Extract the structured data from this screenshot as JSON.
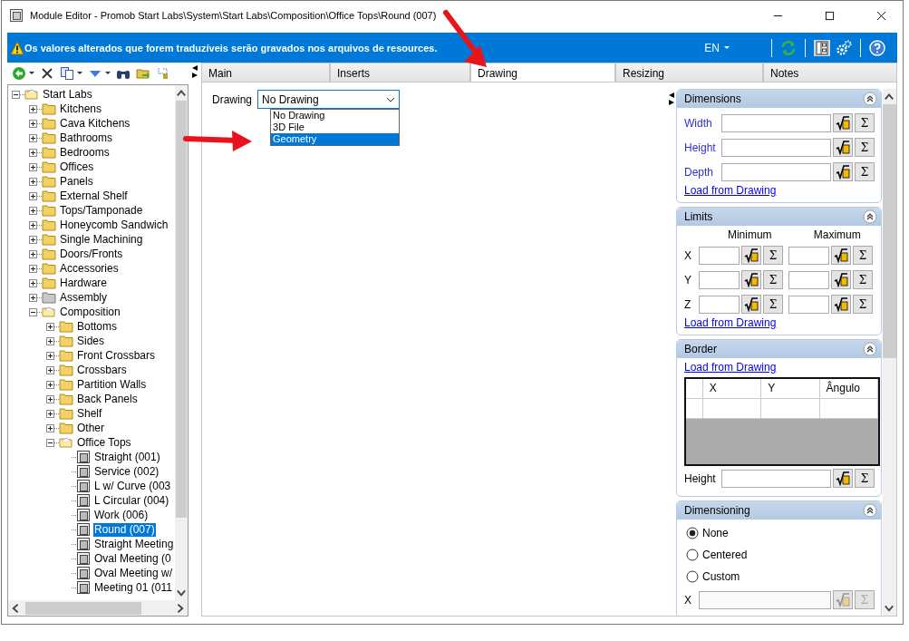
{
  "window": {
    "title": "Module Editor - Promob Start Labs\\System\\Start Labs\\Composition\\Office Tops\\Round (007)"
  },
  "banner": {
    "message": "Os valores alterados que forem traduzíveis serão gravados nos arquivos de resources.",
    "language": "EN"
  },
  "tree": [
    {
      "label": "Start Labs",
      "kind": "folder",
      "expanded": true,
      "selected": false,
      "children": [
        {
          "label": "Kitchens",
          "kind": "folder",
          "expanded": false,
          "selected": false
        },
        {
          "label": "Cava Kitchens",
          "kind": "folder",
          "expanded": false,
          "selected": false
        },
        {
          "label": "Bathrooms",
          "kind": "folder",
          "expanded": false,
          "selected": false
        },
        {
          "label": "Bedrooms",
          "kind": "folder",
          "expanded": false,
          "selected": false
        },
        {
          "label": "Offices",
          "kind": "folder",
          "expanded": false,
          "selected": false
        },
        {
          "label": "Panels",
          "kind": "folder",
          "expanded": false,
          "selected": false
        },
        {
          "label": "External Shelf",
          "kind": "folder",
          "expanded": false,
          "selected": false
        },
        {
          "label": "Tops/Tamponade",
          "kind": "folder",
          "expanded": false,
          "selected": false
        },
        {
          "label": "Honeycomb Sandwich",
          "kind": "folder",
          "expanded": false,
          "selected": false
        },
        {
          "label": "Single Machining",
          "kind": "folder",
          "expanded": false,
          "selected": false
        },
        {
          "label": "Doors/Fronts",
          "kind": "folder",
          "expanded": false,
          "selected": false
        },
        {
          "label": "Accessories",
          "kind": "folder",
          "expanded": false,
          "selected": false
        },
        {
          "label": "Hardware",
          "kind": "folder",
          "expanded": false,
          "selected": false
        },
        {
          "label": "Assembly",
          "kind": "gray-folder",
          "expanded": false,
          "selected": false
        },
        {
          "label": "Composition",
          "kind": "folder",
          "expanded": true,
          "selected": false,
          "children": [
            {
              "label": "Bottoms",
              "kind": "folder",
              "expanded": false,
              "selected": false
            },
            {
              "label": "Sides",
              "kind": "folder",
              "expanded": false,
              "selected": false
            },
            {
              "label": "Front Crossbars",
              "kind": "folder",
              "expanded": false,
              "selected": false
            },
            {
              "label": "Crossbars",
              "kind": "folder",
              "expanded": false,
              "selected": false
            },
            {
              "label": "Partition Walls",
              "kind": "folder",
              "expanded": false,
              "selected": false
            },
            {
              "label": "Back Panels",
              "kind": "folder",
              "expanded": false,
              "selected": false
            },
            {
              "label": "Shelf",
              "kind": "folder",
              "expanded": false,
              "selected": false
            },
            {
              "label": "Other",
              "kind": "folder",
              "expanded": false,
              "selected": false
            },
            {
              "label": "Office Tops",
              "kind": "folder",
              "expanded": true,
              "selected": false,
              "children": [
                {
                  "label": "Straight (001)",
                  "kind": "module",
                  "selected": false
                },
                {
                  "label": "Service (002)",
                  "kind": "module",
                  "selected": false
                },
                {
                  "label": "L w/ Curve (003",
                  "kind": "module",
                  "selected": false
                },
                {
                  "label": "L Circular (004)",
                  "kind": "module",
                  "selected": false
                },
                {
                  "label": "Work (006)",
                  "kind": "module",
                  "selected": false
                },
                {
                  "label": "Round (007)",
                  "kind": "module",
                  "selected": true
                },
                {
                  "label": "Straight Meeting",
                  "kind": "module",
                  "selected": false
                },
                {
                  "label": "Oval Meeting (0",
                  "kind": "module",
                  "selected": false
                },
                {
                  "label": "Oval Meeting w/",
                  "kind": "module",
                  "selected": false
                },
                {
                  "label": "Meeting 01 (011",
                  "kind": "module",
                  "selected": false
                }
              ]
            }
          ]
        }
      ]
    }
  ],
  "tabs": [
    {
      "label": "Main",
      "selected": false
    },
    {
      "label": "Inserts",
      "selected": false
    },
    {
      "label": "Drawing",
      "selected": true
    },
    {
      "label": "Resizing",
      "selected": false
    },
    {
      "label": "Notes",
      "selected": false
    }
  ],
  "drawing": {
    "label": "Drawing",
    "value": "No Drawing",
    "expanded": true,
    "options": [
      {
        "label": "No Drawing",
        "highlighted": false
      },
      {
        "label": "3D File",
        "highlighted": false
      },
      {
        "label": "Geometry",
        "highlighted": true
      }
    ]
  },
  "dimensions": {
    "title": "Dimensions",
    "fields": [
      {
        "label": "Width",
        "sum": "Σ"
      },
      {
        "label": "Height",
        "sum": "Σ"
      },
      {
        "label": "Depth",
        "sum": "Σ"
      }
    ],
    "link": "Load from Drawing"
  },
  "limits": {
    "title": "Limits",
    "columns": [
      "Minimum",
      "Maximum"
    ],
    "rows": [
      {
        "label": "X",
        "sums": [
          "Σ",
          "Σ"
        ]
      },
      {
        "label": "Y",
        "sums": [
          "Σ",
          "Σ"
        ]
      },
      {
        "label": "Z",
        "sums": [
          "Σ",
          "Σ"
        ]
      }
    ],
    "link": "Load from Drawing"
  },
  "border": {
    "title": "Border",
    "link": "Load from Drawing",
    "columns": [
      "X",
      "Y",
      "Ângulo"
    ],
    "height_label": "Height",
    "height_sum": "Σ"
  },
  "dimensioning": {
    "title": "Dimensioning",
    "options": [
      {
        "label": "None",
        "selected": true
      },
      {
        "label": "Centered",
        "selected": false
      },
      {
        "label": "Custom",
        "selected": false
      }
    ],
    "x_label": "X",
    "x_sum": "Σ",
    "x_disabled": true
  }
}
